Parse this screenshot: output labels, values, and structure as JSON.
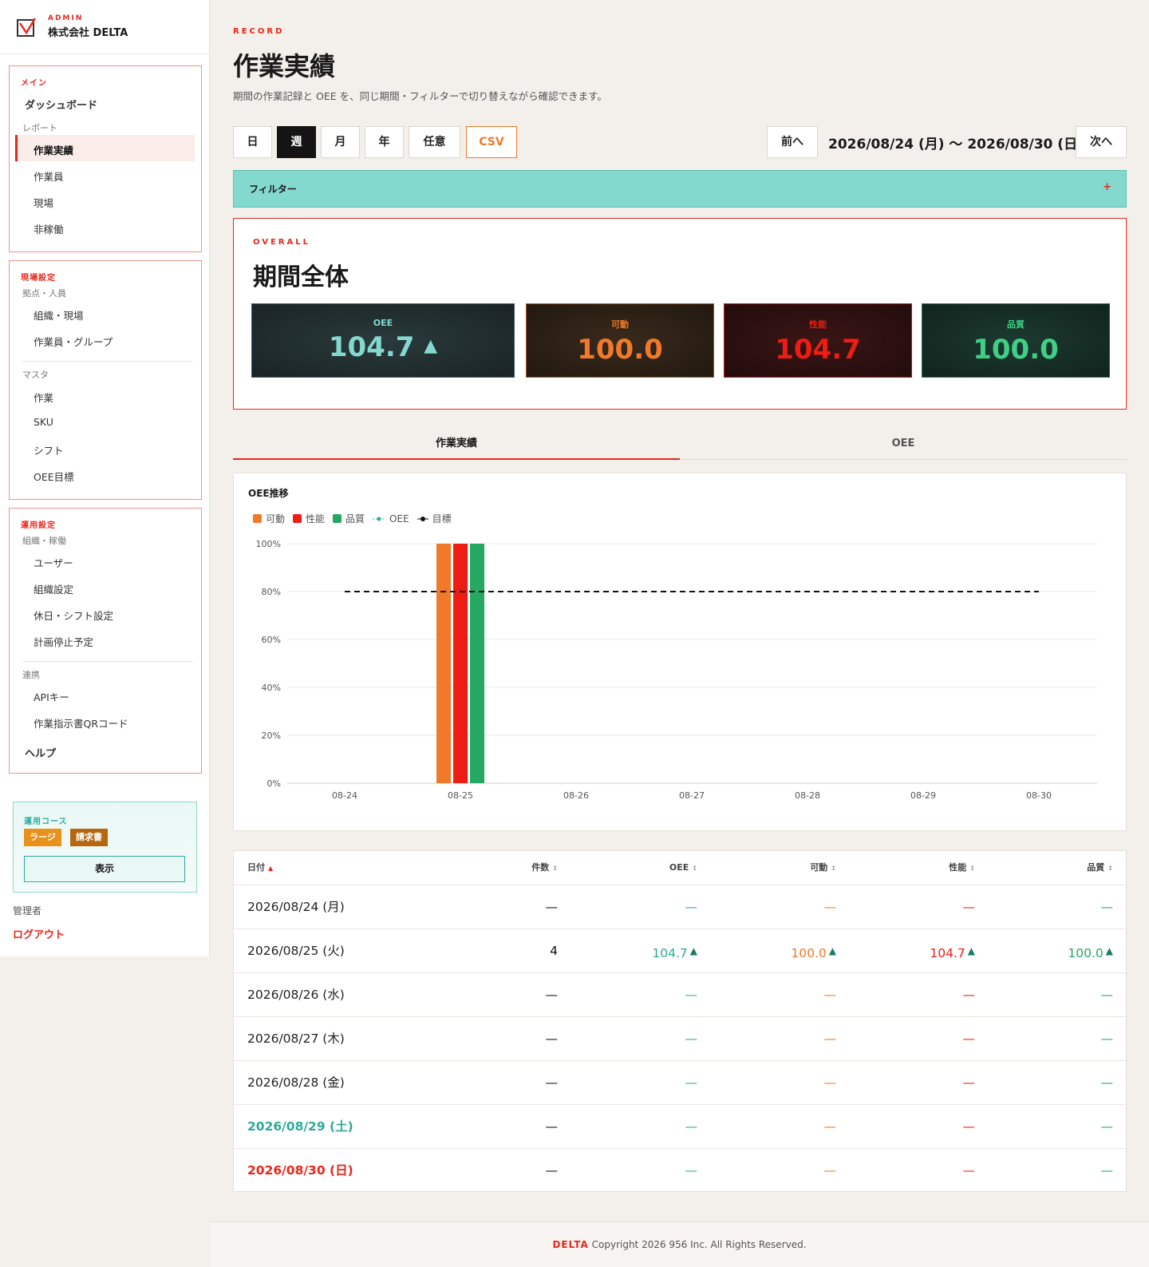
{
  "brand": {
    "small": "ADMIN",
    "name": "株式会社 DELTA"
  },
  "nav": {
    "g1": {
      "title": "メイン",
      "dashboard": "ダッシュボード",
      "sub": "レポート",
      "items": [
        "作業実績",
        "作業員",
        "現場",
        "非稼働"
      ]
    },
    "g2": {
      "title": "現場設定",
      "sub1": "拠点・人員",
      "items1": [
        "組織・現場",
        "作業員・グループ"
      ],
      "sub2": "マスタ",
      "items2": [
        "作業",
        "SKU",
        "シフト",
        "OEE目標"
      ]
    },
    "g3": {
      "title": "運用設定",
      "sub1": "組織・稼働",
      "items1": [
        "ユーザー",
        "組織設定",
        "休日・シフト設定",
        "計画停止予定"
      ],
      "sub2": "連携",
      "items2": [
        "APIキー",
        "作業指示書QRコード"
      ],
      "help": "ヘルプ"
    }
  },
  "course": {
    "label": "運用コース",
    "badge1": "ラージ",
    "badge2": "請求書",
    "show": "表示"
  },
  "user": {
    "role": "管理者",
    "logout": "ログアウト"
  },
  "page": {
    "eyebrow": "RECORD",
    "title": "作業実績",
    "desc": "期間の作業記録と OEE を、同じ期間・フィルターで切り替えながら確認できます。"
  },
  "period": {
    "buttons": [
      "日",
      "週",
      "月",
      "年",
      "任意"
    ],
    "csv": "CSV",
    "prev": "前へ",
    "next": "次へ",
    "range": "2026/08/24 (月) 〜 2026/08/30 (日)"
  },
  "filter": {
    "label": "フィルター",
    "toggle": "+"
  },
  "overall": {
    "eyebrow": "OVERALL",
    "title": "期間全体",
    "kpis": [
      {
        "label": "OEE",
        "value": "104.7",
        "arrow": "▲"
      },
      {
        "label": "可動",
        "value": "100.0"
      },
      {
        "label": "性能",
        "value": "104.7"
      },
      {
        "label": "品質",
        "value": "100.0"
      }
    ]
  },
  "tabs": [
    "作業実績",
    "OEE"
  ],
  "chart_title": "OEE推移",
  "chart_data": {
    "type": "bar",
    "categories": [
      "08-24",
      "08-25",
      "08-26",
      "08-27",
      "08-28",
      "08-29",
      "08-30"
    ],
    "series": [
      {
        "name": "可動",
        "color": "#f07a2a",
        "values": [
          null,
          100,
          null,
          null,
          null,
          null,
          null
        ]
      },
      {
        "name": "性能",
        "color": "#ee1c12",
        "values": [
          null,
          100,
          null,
          null,
          null,
          null,
          null
        ]
      },
      {
        "name": "品質",
        "color": "#24a862",
        "values": [
          null,
          100,
          null,
          null,
          null,
          null,
          null
        ]
      },
      {
        "name": "OEE",
        "color": "#2fa99a",
        "values": [
          null,
          null,
          null,
          null,
          null,
          null,
          null
        ]
      },
      {
        "name": "目標",
        "color": "#111111",
        "values": [
          80,
          80,
          80,
          80,
          80,
          80,
          80
        ]
      }
    ],
    "ylim": [
      0,
      100
    ],
    "yticks": [
      "0%",
      "20%",
      "40%",
      "60%",
      "80%",
      "100%"
    ],
    "grid": true,
    "legend": "top-left"
  },
  "table": {
    "headers": [
      "日付",
      "件数",
      "OEE",
      "可動",
      "性能",
      "品質"
    ],
    "sort_asc": "▲",
    "sort_both": "↕",
    "dash": "—",
    "rows": [
      {
        "date": "2026/08/24 (月)",
        "count": "—",
        "oee": "—",
        "avail": "—",
        "perf": "—",
        "qual": "—"
      },
      {
        "date": "2026/08/25 (火)",
        "count": "4",
        "oee": "104.7",
        "avail": "100.0",
        "perf": "104.7",
        "qual": "100.0",
        "arrow": "▲"
      },
      {
        "date": "2026/08/26 (水)",
        "count": "—",
        "oee": "—",
        "avail": "—",
        "perf": "—",
        "qual": "—"
      },
      {
        "date": "2026/08/27 (木)",
        "count": "—",
        "oee": "—",
        "avail": "—",
        "perf": "—",
        "qual": "—"
      },
      {
        "date": "2026/08/28 (金)",
        "count": "—",
        "oee": "—",
        "avail": "—",
        "perf": "—",
        "qual": "—"
      },
      {
        "date": "2026/08/29 (土)",
        "count": "—",
        "oee": "—",
        "avail": "—",
        "perf": "—",
        "qual": "—"
      },
      {
        "date": "2026/08/30 (日)",
        "count": "—",
        "oee": "—",
        "avail": "—",
        "perf": "—",
        "qual": "—"
      }
    ]
  },
  "footer": {
    "brand": "DELTA",
    "text": "Copyright 2026 956 Inc. All Rights Reserved."
  }
}
